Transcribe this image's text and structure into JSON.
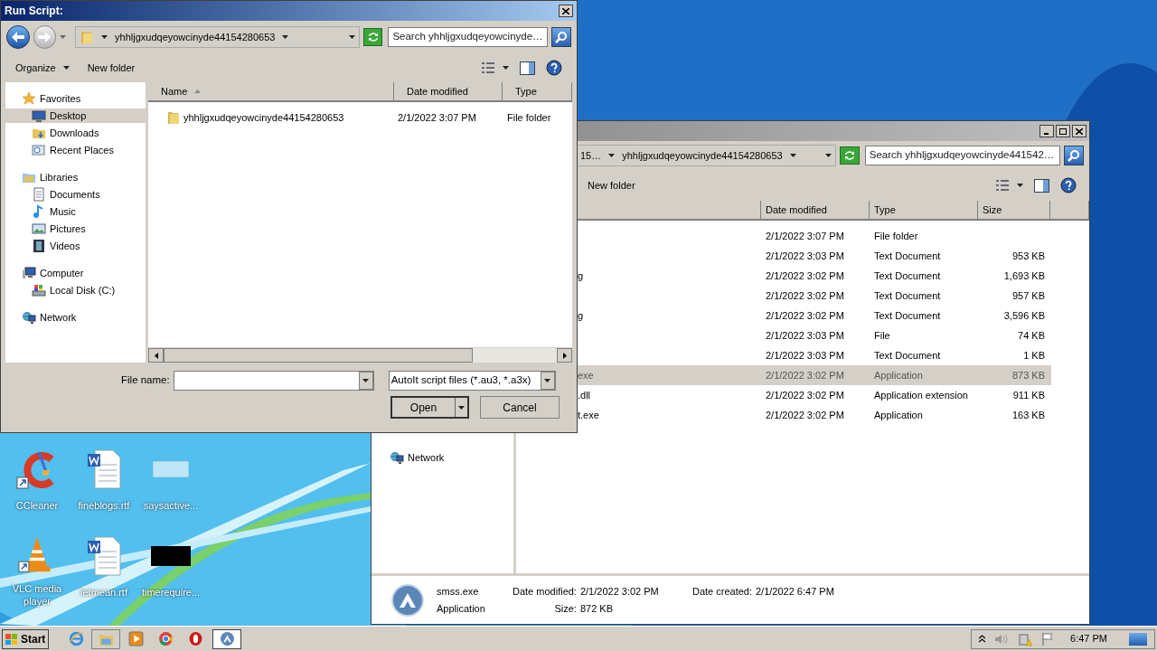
{
  "dialog": {
    "title": "Run Script:",
    "address": [
      "yhhljgxudqeyowcinyde44154280653"
    ],
    "search": {
      "placeholder": "Search yhhljgxudqeyowcinyde…"
    },
    "toolbar": [
      {
        "label": "Organize",
        "menu": true
      },
      {
        "label": "New folder",
        "menu": false
      }
    ],
    "nav": [
      {
        "label": "Favorites",
        "kind": "star",
        "children": [
          {
            "label": "Desktop",
            "kind": "desktop",
            "selected": true
          },
          {
            "label": "Downloads",
            "kind": "downloads",
            "selected": false
          },
          {
            "label": "Recent Places",
            "kind": "recent",
            "selected": false
          }
        ]
      },
      {
        "label": "Libraries",
        "kind": "libraries",
        "children": [
          {
            "label": "Documents",
            "kind": "documents",
            "selected": false
          },
          {
            "label": "Music",
            "kind": "music",
            "selected": false
          },
          {
            "label": "Pictures",
            "kind": "pictures",
            "selected": false
          },
          {
            "label": "Videos",
            "kind": "videos",
            "selected": false
          }
        ]
      },
      {
        "label": "Computer",
        "kind": "computer",
        "children": [
          {
            "label": "Local Disk (C:)",
            "kind": "disk",
            "selected": false
          }
        ]
      },
      {
        "label": "Network",
        "kind": "network"
      }
    ],
    "columns": [
      {
        "label": "Name",
        "sorted": true
      },
      {
        "label": "Date modified",
        "sorted": false
      },
      {
        "label": "Type",
        "sorted": false
      }
    ],
    "rows": [
      {
        "name": "yhhljgxudqeyowcinyde44154280653",
        "date": "2/1/2022 3:07 PM",
        "type": "File folder"
      }
    ],
    "file_name": {
      "label": "File name:"
    },
    "filter": "AutoIt script files (*.au3, *.a3x)",
    "buttons": [
      {
        "label": "Open",
        "kind": "split"
      },
      {
        "label": "Cancel",
        "kind": "plain"
      }
    ]
  },
  "explorer": {
    "address": [
      "15…",
      "yhhljgxudqeyowcinyde44154280653"
    ],
    "search": {
      "placeholder": "Search yhhljgxudqeyowcinyde441542…"
    },
    "toolbar": [
      "New folder"
    ],
    "nav": [
      {
        "label": "Network",
        "kind": "network"
      }
    ],
    "columns": [
      "Date modified",
      "Type",
      "Size"
    ],
    "rows": [
      {
        "date": "2/1/2022 3:07 PM",
        "type": "File folder",
        "selected": false
      },
      {
        "date": "2/1/2022 3:03 PM",
        "type": "Text Document",
        "size": "953 KB",
        "selected": false
      },
      {
        "name": "g",
        "date": "2/1/2022 3:02 PM",
        "type": "Text Document",
        "size": "1,693 KB",
        "selected": false
      },
      {
        "date": "2/1/2022 3:02 PM",
        "type": "Text Document",
        "size": "957 KB",
        "selected": false
      },
      {
        "name": "g",
        "date": "2/1/2022 3:02 PM",
        "type": "Text Document",
        "size": "3,596 KB",
        "selected": false
      },
      {
        "date": "2/1/2022 3:03 PM",
        "type": "File",
        "size": "74 KB",
        "selected": false
      },
      {
        "date": "2/1/2022 3:03 PM",
        "type": "Text Document",
        "size": "1 KB",
        "selected": false
      },
      {
        "name": "exe",
        "date": "2/1/2022 3:02 PM",
        "type": "Application",
        "size": "873 KB",
        "selected": true
      },
      {
        "name": ".dll",
        "date": "2/1/2022 3:02 PM",
        "type": "Application extension",
        "size": "911 KB",
        "selected": false
      },
      {
        "name": "t.exe",
        "date": "2/1/2022 3:02 PM",
        "type": "Application",
        "size": "163 KB",
        "selected": false
      }
    ],
    "details": {
      "name": "smss.exe",
      "type": "Application",
      "modified_label": "Date modified:",
      "modified": "2/1/2022 3:02 PM",
      "size_label": "Size:",
      "size": "872 KB",
      "created_label": "Date created:",
      "created": "2/1/2022 6:47 PM"
    }
  },
  "desktop_icons": [
    {
      "label": "CCleaner",
      "kind": "ccleaner"
    },
    {
      "label": "fineblogs.rtf",
      "kind": "word"
    },
    {
      "label": "saysactive...",
      "kind": "blank"
    },
    {
      "label": "VLC media player",
      "kind": "vlc"
    },
    {
      "label": "letmean.rtf",
      "kind": "word"
    },
    {
      "label": "timerequire...",
      "kind": "black"
    }
  ],
  "taskbar": {
    "start": "Start",
    "apps": [
      {
        "kind": "ie",
        "open": false,
        "selected": false
      },
      {
        "kind": "explorer",
        "open": true,
        "selected": false
      },
      {
        "kind": "media",
        "open": false,
        "selected": false
      },
      {
        "kind": "chrome",
        "open": false,
        "selected": false
      },
      {
        "kind": "opera",
        "open": false,
        "selected": false
      },
      {
        "kind": "autoit",
        "open": true,
        "selected": true
      }
    ],
    "clock": "6:47 PM"
  }
}
